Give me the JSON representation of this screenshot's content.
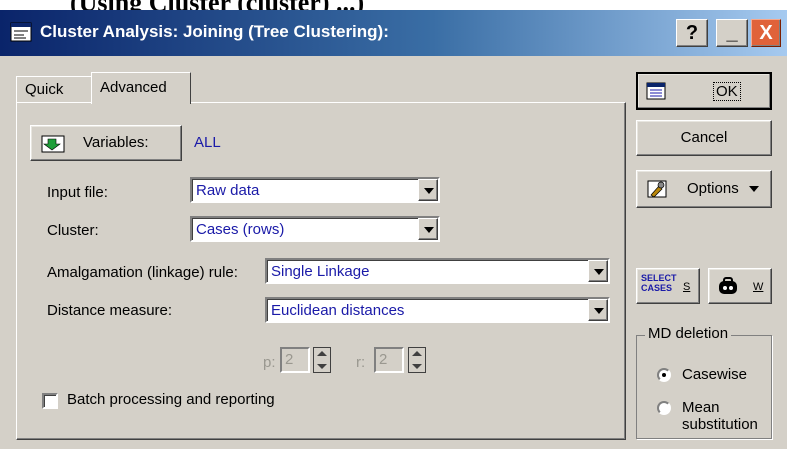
{
  "window": {
    "title": "Cluster Analysis: Joining (Tree Clustering):",
    "help_label": "?",
    "minimize_label": "_",
    "close_label": "X"
  },
  "tabs": [
    {
      "label": "Quick"
    },
    {
      "label": "Advanced"
    }
  ],
  "variables": {
    "button_label": "Variables:",
    "value": "ALL"
  },
  "fields": {
    "input_file": {
      "label": "Input file:",
      "value": "Raw data"
    },
    "cluster": {
      "label": "Cluster:",
      "value": "Cases (rows)"
    },
    "amalgamation": {
      "label": "Amalgamation (linkage) rule:",
      "value": "Single Linkage"
    },
    "distance": {
      "label": "Distance measure:",
      "value": "Euclidean distances"
    }
  },
  "spinners": {
    "p": {
      "label": "p:",
      "value": "2"
    },
    "r": {
      "label": "r:",
      "value": "2"
    }
  },
  "batch": {
    "label": "Batch processing and reporting",
    "checked": false
  },
  "buttons": {
    "ok": "OK",
    "cancel": "Cancel",
    "options": "Options",
    "select_cases_icon": "SELECT\nCASES",
    "select_cases_key": "S",
    "weights_key": "W"
  },
  "md_deletion": {
    "title": "MD deletion",
    "options": [
      {
        "label": "Casewise",
        "checked": true
      },
      {
        "label": "Mean substitution",
        "checked": false
      }
    ]
  },
  "cut_caption": "(Using Cluster (cluster) ...)"
}
